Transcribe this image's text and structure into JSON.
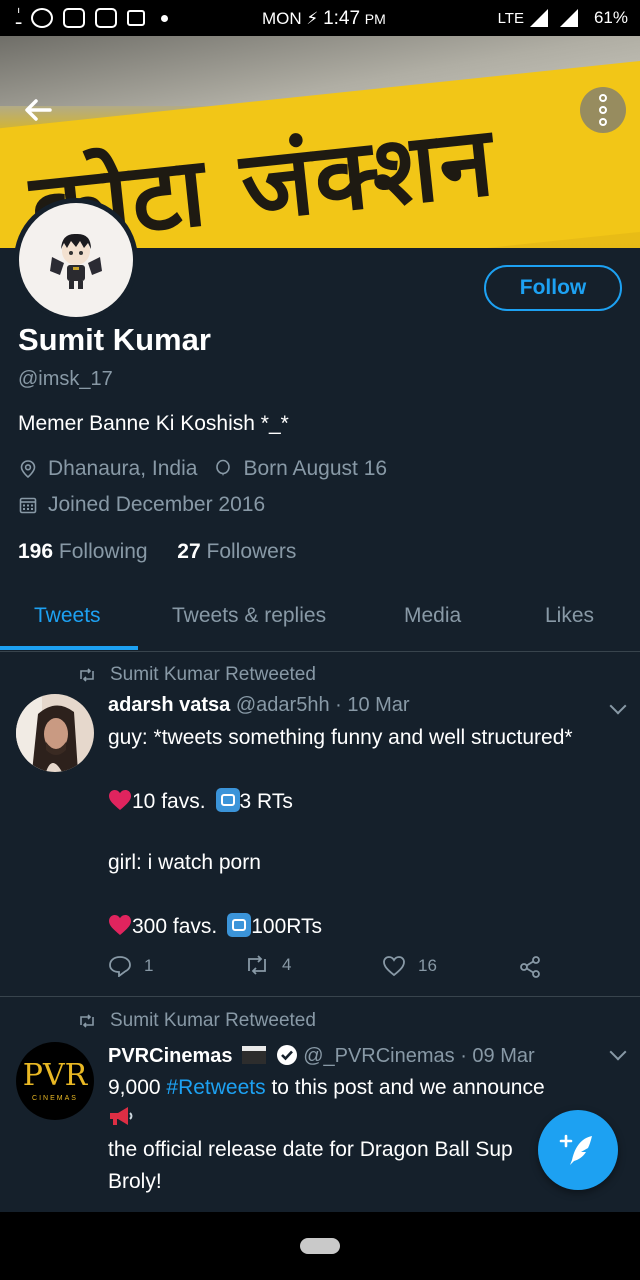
{
  "status_bar": {
    "day": "MON",
    "time": "1:47",
    "ampm": "PM",
    "network": "LTE",
    "battery": "61%"
  },
  "banner": {
    "sign_text": "कोटा जंक्शन"
  },
  "profile": {
    "name": "Sumit Kumar",
    "handle": "@imsk_17",
    "bio": "Memer Banne Ki Koshish *_*",
    "location": "Dhanaura, India",
    "birthday": "Born August 16",
    "joined": "Joined December 2016",
    "following_count": "196",
    "following_label": "Following",
    "followers_count": "27",
    "followers_label": "Followers",
    "follow_button": "Follow"
  },
  "tabs": [
    {
      "label": "Tweets",
      "active": true
    },
    {
      "label": "Tweets & replies",
      "active": false
    },
    {
      "label": "Media",
      "active": false
    },
    {
      "label": "Likes",
      "active": false
    }
  ],
  "tweets": [
    {
      "retweeted_by": "Sumit Kumar Retweeted",
      "author": "adarsh vatsa",
      "handle_date": "@adar5hh · 10 Mar",
      "lines": {
        "l1": "guy: *tweets something funny and well structured*",
        "l2a": "10 favs.",
        "l2b": "3 RTs",
        "l3": "girl: i watch porn",
        "l4a": "300 favs.",
        "l4b": "100RTs"
      },
      "replies": "1",
      "retweets": "4",
      "likes": "16"
    },
    {
      "retweeted_by": "Sumit Kumar Retweeted",
      "author": "PVRCinemas",
      "handle_date": "@_PVRCinemas · 09 Mar",
      "logo_text": "PVR",
      "logo_sub": "CINEMAS",
      "lines": {
        "l1a": "9,000 ",
        "l1b": "#Retweets",
        "l1c": " to this post and we announce",
        "l2": " the official release date for Dragon Ball Sup",
        "l3": "Broly!"
      }
    }
  ],
  "colors": {
    "background": "#15202b",
    "accent": "#1da1f2",
    "secondary_text": "#8899a6",
    "like_red": "#e0245e"
  }
}
